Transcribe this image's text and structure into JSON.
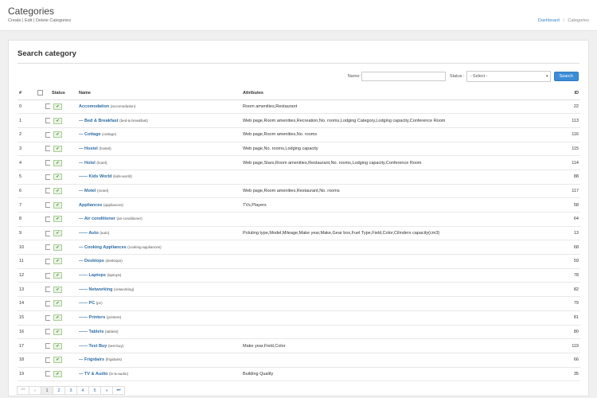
{
  "header": {
    "title": "Categories",
    "subtitle": "Create | Edit | Delete Categories",
    "breadcrumb": {
      "home": "Dashboard",
      "separator": "/",
      "current": "Categories"
    }
  },
  "panel": {
    "title": "Search category"
  },
  "search": {
    "name_label": "Name:",
    "name_value": "",
    "status_label": "Status :",
    "status_value": "- Select -",
    "button_label": "Search"
  },
  "table": {
    "headers": {
      "num": "#",
      "status": "Status",
      "name": "Name",
      "attributes": "Attributes",
      "id": "ID"
    },
    "rows": [
      {
        "num": "0",
        "dash": "",
        "name": "Accomodation",
        "slug": "(accomodation)",
        "attributes": "Room amenities,Restaurant",
        "id": "22"
      },
      {
        "num": "1",
        "dash": "— ",
        "name": "Bed & Breakfast",
        "slug": "(bed-&-breakfast)",
        "attributes": "Web page,Room amenities,Recreation,No. rooms,Lodging Category,Lodging capacity,Conference Room",
        "id": "113"
      },
      {
        "num": "2",
        "dash": "— ",
        "name": "Cottage",
        "slug": "(cottage)",
        "attributes": "Web page,Room amenities,No. rooms",
        "id": "116"
      },
      {
        "num": "3",
        "dash": "— ",
        "name": "Hostel",
        "slug": "(hostel)",
        "attributes": "Web page,No. rooms,Lodging capacity",
        "id": "115"
      },
      {
        "num": "4",
        "dash": "— ",
        "name": "Hotel",
        "slug": "(hotel)",
        "attributes": "Web page,Stars,Room amenities,Restaurant,No. rooms,Lodging capacity,Conference Room",
        "id": "114"
      },
      {
        "num": "5",
        "dash": "—— ",
        "name": "Kids World",
        "slug": "(kids-world)",
        "attributes": "",
        "id": "88"
      },
      {
        "num": "6",
        "dash": "— ",
        "name": "Motel",
        "slug": "(motel)",
        "attributes": "Web page,Room amenities,Restaurant,No. rooms",
        "id": "117"
      },
      {
        "num": "7",
        "dash": "",
        "name": "Appliances",
        "slug": "(appliances)",
        "attributes": "TVs,Players",
        "id": "58"
      },
      {
        "num": "8",
        "dash": "— ",
        "name": "Air conditioner",
        "slug": "(air-conditioner)",
        "attributes": "",
        "id": "64"
      },
      {
        "num": "9",
        "dash": "—— ",
        "name": "Auto",
        "slug": "(auto)",
        "attributes": "Poluting type,Model,Mileage,Make year,Make,Gear box,Fuel Type,Field,Color,Cilinders capacity(cm3)",
        "id": "13"
      },
      {
        "num": "10",
        "dash": "— ",
        "name": "Cooking Appliances",
        "slug": "(cooking-appliances)",
        "attributes": "",
        "id": "68"
      },
      {
        "num": "11",
        "dash": "— ",
        "name": "Desktops",
        "slug": "(desktops)",
        "attributes": "",
        "id": "59"
      },
      {
        "num": "12",
        "dash": "—— ",
        "name": "Laptops",
        "slug": "(laptops)",
        "attributes": "",
        "id": "78"
      },
      {
        "num": "13",
        "dash": "—— ",
        "name": "Networking",
        "slug": "(networking)",
        "attributes": "",
        "id": "82"
      },
      {
        "num": "14",
        "dash": "—— ",
        "name": "PC",
        "slug": "(pc)",
        "attributes": "",
        "id": "79"
      },
      {
        "num": "15",
        "dash": "—— ",
        "name": "Printers",
        "slug": "(printers)",
        "attributes": "",
        "id": "81"
      },
      {
        "num": "16",
        "dash": "—— ",
        "name": "Tablets",
        "slug": "(tablets)",
        "attributes": "",
        "id": "80"
      },
      {
        "num": "17",
        "dash": "—— ",
        "name": "Test Buy",
        "slug": "(test-buy)",
        "attributes": "Make year,Field,Color",
        "id": "119"
      },
      {
        "num": "18",
        "dash": "— ",
        "name": "Frigidairs",
        "slug": "(frigidairs)",
        "attributes": "",
        "id": "66"
      },
      {
        "num": "19",
        "dash": "— ",
        "name": "TV & Audio",
        "slug": "(tv-&-audio)",
        "attributes": "Building Quality",
        "id": "35"
      }
    ]
  },
  "pagination": {
    "first": "⏮",
    "prev": "«",
    "pages": [
      "1",
      "2",
      "3",
      "4",
      "5"
    ],
    "active_page": "1",
    "next": "»",
    "last": "⏭"
  },
  "icons": {
    "check": "✔",
    "caret": "▾"
  },
  "colors": {
    "link": "#2e6da4",
    "accent": "#3c8dd6",
    "status_ok": "#3c7a2c"
  }
}
